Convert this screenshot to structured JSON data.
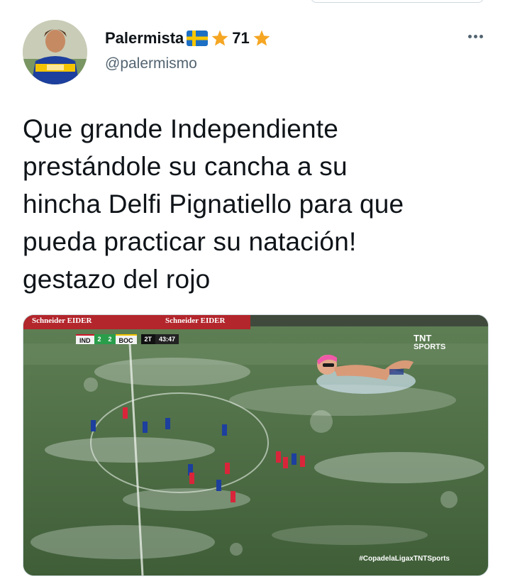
{
  "tweet": {
    "author": {
      "display_name": "Palermista",
      "badge_number": "71",
      "handle": "@palermismo",
      "avatar": "avatar-photo",
      "flag": "sweden-flag-icon",
      "star": "star-icon"
    },
    "more_icon": "more-dots-icon",
    "text": "Que grande Independiente\nprestándole su cancha a su\nhincha Delfi Pignatiello para que\npueda practicar su natación!\ngestazo del rojo",
    "media": {
      "scorebug": {
        "team1": "IND",
        "score1": "2",
        "score2": "2",
        "team2": "BOC",
        "half": "2T",
        "clock": "43:47"
      },
      "banner_left": "Schneider EIDER",
      "banner_right": "Schneider EIDER",
      "broadcaster_line1": "TNT",
      "broadcaster_line2": "SPORTS",
      "hashtag": "#CopadelaLigaxTNTSports"
    }
  },
  "colors": {
    "text": "#0f1419",
    "secondary": "#536471",
    "border": "#cfd9de",
    "star": "#f5a623",
    "pitch": "#4c6a43"
  }
}
